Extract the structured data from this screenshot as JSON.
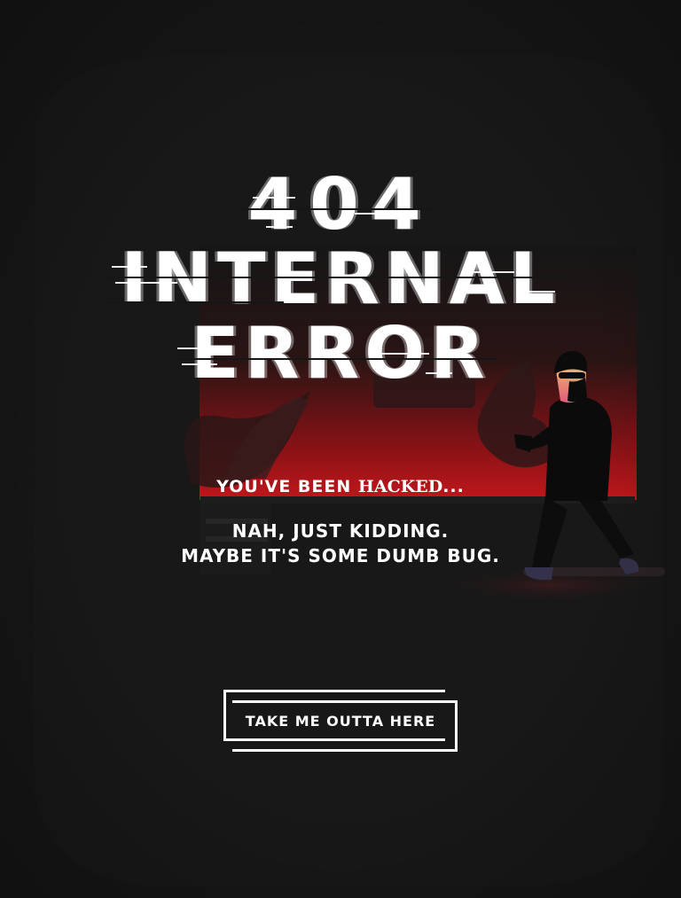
{
  "title": {
    "code": "404",
    "line1": "INTERNAL",
    "line2": "ERROR"
  },
  "message": {
    "hacked_prefix": "YOU'VE BEEN ",
    "hacked_word": "HACKED",
    "hacked_suffix": "...",
    "line2": "NAH, JUST KIDDING.",
    "line3": "MAYBE IT'S SOME DUMB BUG."
  },
  "cta": {
    "label": "TAKE ME OUTTA HERE"
  },
  "colors": {
    "background": "#161616",
    "accent_red": "#c0171b",
    "text": "#ffffff"
  }
}
